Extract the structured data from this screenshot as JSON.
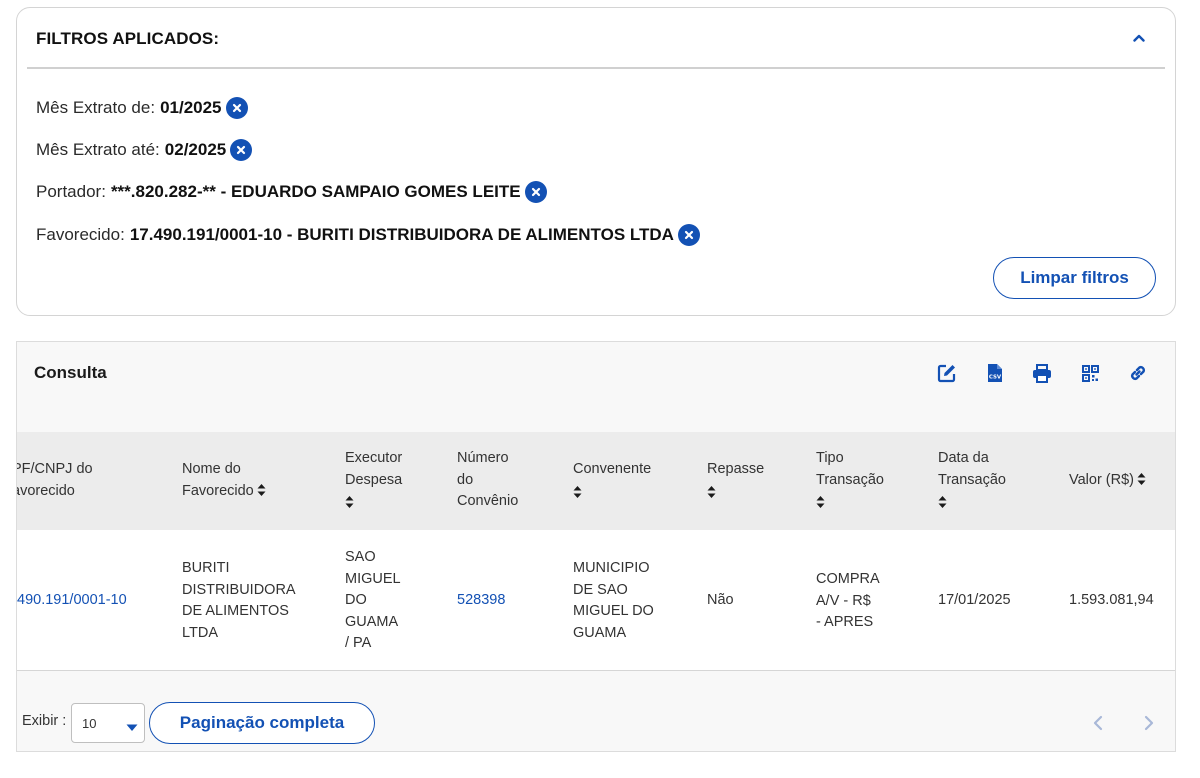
{
  "filters": {
    "title": "FILTROS APLICADOS:",
    "items": [
      {
        "label": "Mês Extrato de:",
        "value": "01/2025"
      },
      {
        "label": "Mês Extrato até:",
        "value": "02/2025"
      },
      {
        "label": "Portador:",
        "value": "***.820.282-** - EDUARDO SAMPAIO GOMES LEITE"
      },
      {
        "label": "Favorecido:",
        "value": "17.490.191/0001-10 - BURITI DISTRIBUIDORA DE ALIMENTOS LTDA"
      }
    ],
    "clear_label": "Limpar filtros",
    "collapse_icon": "chevron-up-icon",
    "remove_icon": "close-circle-icon"
  },
  "results": {
    "title": "Consulta",
    "toolbar_icons": [
      "edit-icon",
      "csv-icon",
      "print-icon",
      "qr-code-icon",
      "link-icon"
    ],
    "columns": {
      "cpf_cnpj": [
        "PF/CNPJ do",
        "avorecido"
      ],
      "nome": [
        "Nome do",
        "Favorecido"
      ],
      "executor": [
        "Executor",
        "Despesa"
      ],
      "numero": [
        "Número",
        "do",
        "Convênio"
      ],
      "convenente": [
        "Convenente"
      ],
      "repasse": [
        "Repasse"
      ],
      "tipo": [
        "Tipo",
        "Transação"
      ],
      "data": [
        "Data da",
        "Transação"
      ],
      "valor": [
        "Valor (R$)"
      ]
    },
    "row": {
      "cpf_cnpj": "490.191/0001-10",
      "nome": [
        "BURITI",
        "DISTRIBUIDORA",
        "DE ALIMENTOS",
        "LTDA"
      ],
      "executor": [
        "SAO",
        "MIGUEL",
        "DO",
        "GUAMA",
        "/ PA"
      ],
      "numero": "528398",
      "convenente": [
        "MUNICIPIO",
        "DE SAO",
        "MIGUEL DO",
        "GUAMA"
      ],
      "repasse": "Não",
      "tipo": [
        "COMPRA",
        "A/V - R$",
        "- APRES"
      ],
      "data": "17/01/2025",
      "valor": "1.593.081,94"
    },
    "footer": {
      "exibir_label": "Exibir :",
      "page_size": "10",
      "pagination_label": "Paginação completa"
    }
  },
  "colors": {
    "primary": "#1351b4",
    "header_bg": "#ececec",
    "card_bg": "#f8f8f8"
  }
}
